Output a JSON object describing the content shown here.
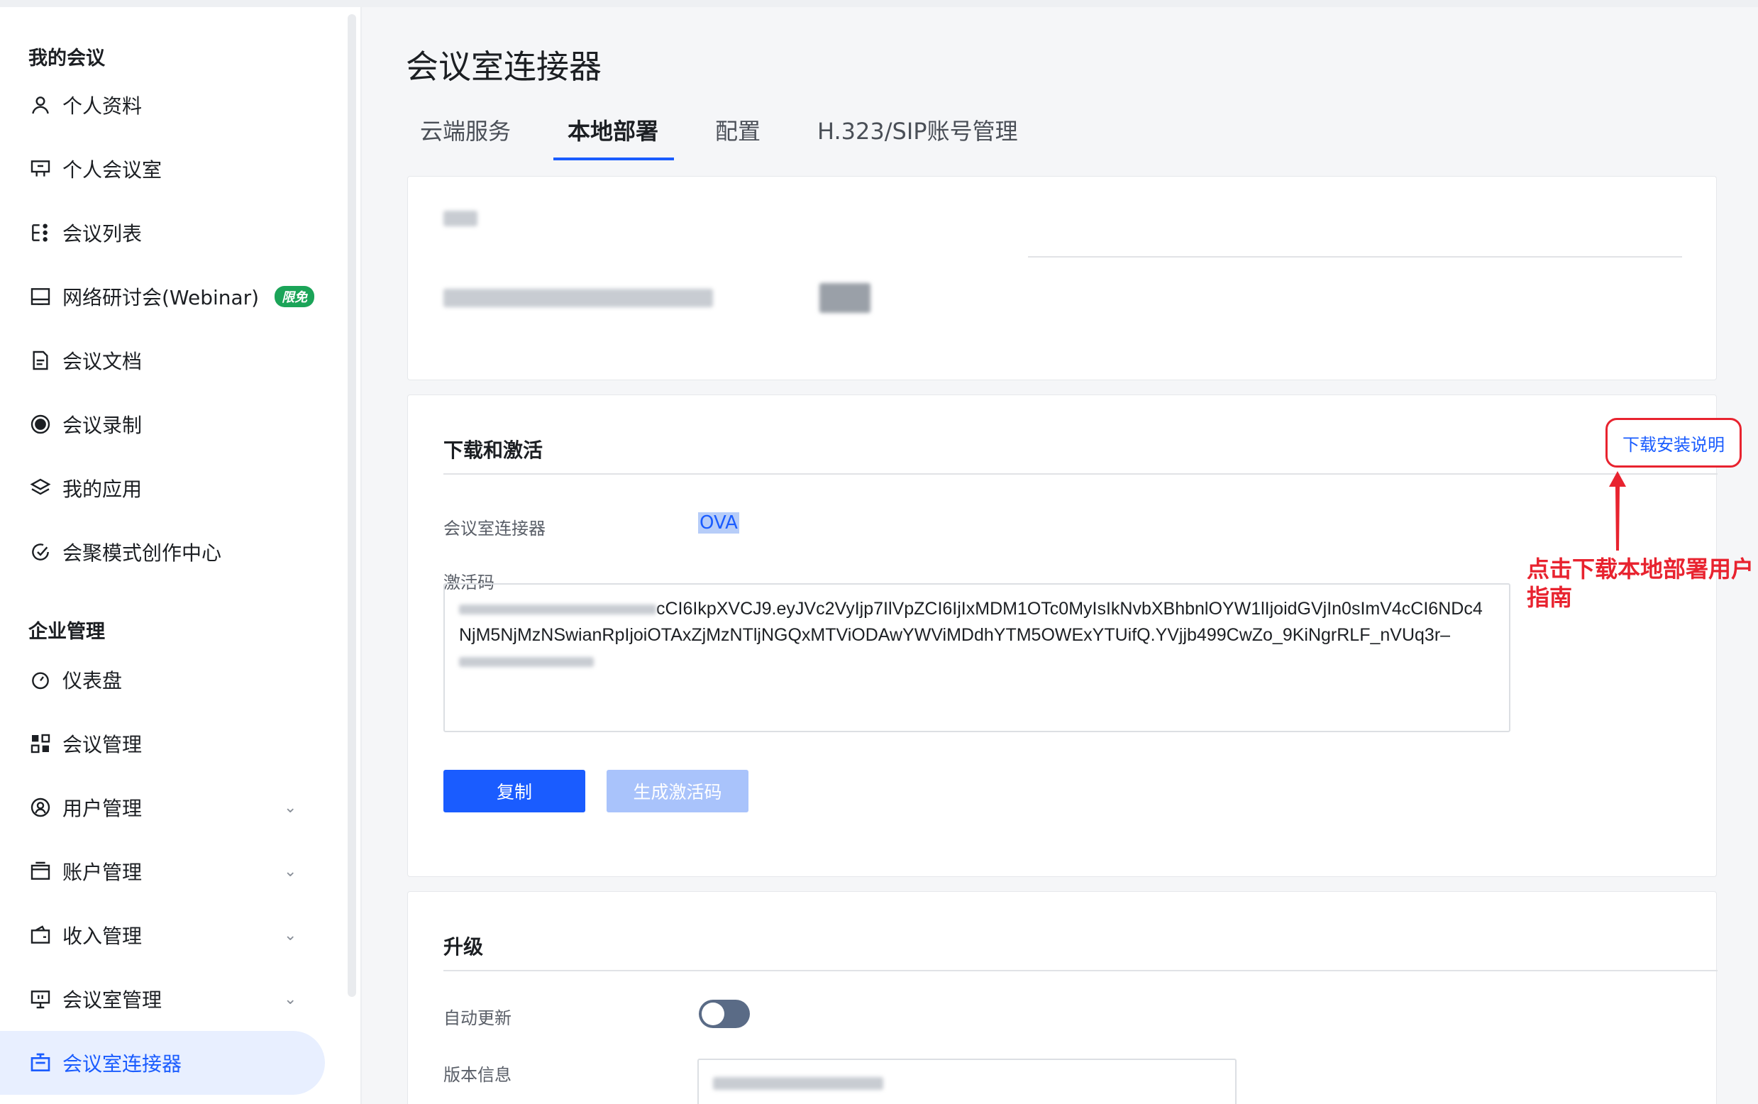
{
  "sidebar": {
    "section_my": "我的会议",
    "my_items": [
      {
        "label": "个人资料",
        "icon": "user-icon"
      },
      {
        "label": "个人会议室",
        "icon": "meeting-room-icon"
      },
      {
        "label": "会议列表",
        "icon": "list-icon"
      },
      {
        "label": "网络研讨会(Webinar)",
        "icon": "webinar-icon",
        "badge": "限免"
      },
      {
        "label": "会议文档",
        "icon": "document-icon"
      },
      {
        "label": "会议录制",
        "icon": "record-icon"
      },
      {
        "label": "我的应用",
        "icon": "apps-icon"
      },
      {
        "label": "会聚模式创作中心",
        "icon": "creation-icon"
      }
    ],
    "section_ent": "企业管理",
    "ent_items": [
      {
        "label": "仪表盘",
        "icon": "dashboard-icon"
      },
      {
        "label": "会议管理",
        "icon": "grid-icon"
      },
      {
        "label": "用户管理",
        "icon": "users-icon",
        "chevron": "⌄"
      },
      {
        "label": "账户管理",
        "icon": "account-icon",
        "chevron": "⌄"
      },
      {
        "label": "收入管理",
        "icon": "wallet-icon",
        "chevron": "⌄"
      },
      {
        "label": "会议室管理",
        "icon": "room-manage-icon",
        "chevron": "⌄"
      },
      {
        "label": "会议室连接器",
        "icon": "connector-icon"
      }
    ]
  },
  "main": {
    "title": "会议室连接器",
    "tabs": [
      "云端服务",
      "本地部署",
      "配置",
      "H.323/SIP账号管理"
    ],
    "active_tab": "本地部署",
    "download_card": {
      "title": "下载和激活",
      "guide_button": "下载安装说明",
      "connector_label": "会议室连接器",
      "connector_value": "OVA",
      "activation_label": "激活码",
      "activation_code": "cCI6IkpXVCJ9.eyJVc2VyIjp7IlVpZCI6IjIxMDM1OTc0MyIsIkNvbXBhbnlOYW1lIjoidGVjIn0sImV4cCI6NDc4NjM5NjMzNSwianRpIjoiOTAxZjMzNTljNGQxMTViODAwYWViMDdhYTM5OWExYTUifQ.YVjjb499CwZo_9KiNgrRLF_nVUq3r–",
      "copy_button": "复制",
      "generate_button": "生成激活码"
    },
    "upgrade_card": {
      "title": "升级",
      "auto_update_label": "自动更新",
      "version_label": "版本信息"
    },
    "annotation": "点击下载本地部署用户指南"
  },
  "colors": {
    "accent": "#1a5cff",
    "annotation_red": "#e8232f",
    "badge_green": "#1ba458"
  }
}
